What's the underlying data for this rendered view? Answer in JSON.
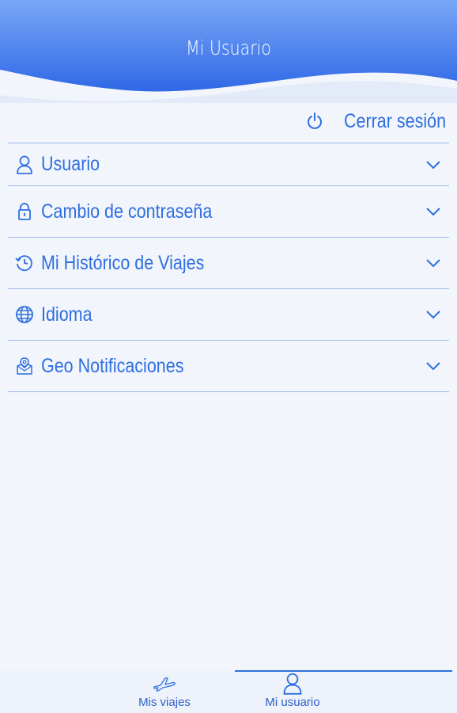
{
  "header": {
    "title": "Mi Usuario"
  },
  "logout": {
    "label": "Cerrar sesión",
    "icon": "power-icon"
  },
  "menu": {
    "items": [
      {
        "label": "Usuario",
        "icon": "user-icon"
      },
      {
        "label": "Cambio de contraseña",
        "icon": "lock-icon"
      },
      {
        "label": "Mi Histórico de Viajes",
        "icon": "history-icon"
      },
      {
        "label": "Idioma",
        "icon": "globe-icon"
      },
      {
        "label": "Geo Notificaciones",
        "icon": "geo-notification-icon"
      }
    ]
  },
  "tabbar": {
    "tabs": [
      {
        "label": "Mis viajes",
        "icon": "plane-icon"
      },
      {
        "label": "Mi usuario",
        "icon": "user-icon",
        "active": true
      }
    ]
  },
  "colors": {
    "accent": "#2e6fe0",
    "header": "#4f86ef",
    "background": "#f2f5fb"
  }
}
